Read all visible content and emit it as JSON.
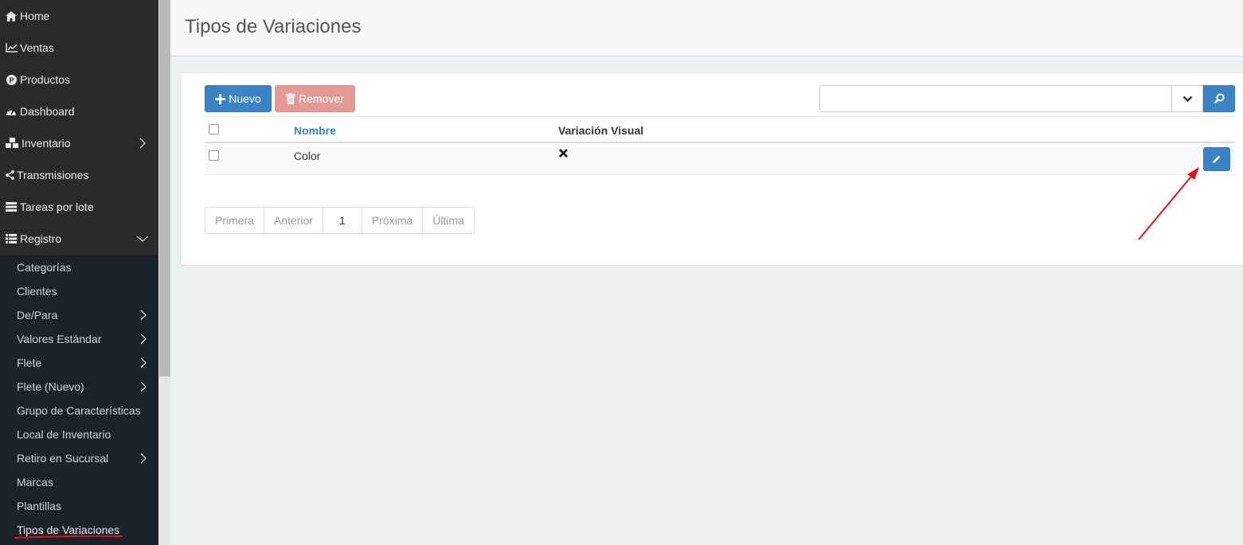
{
  "sidebar": {
    "items": [
      {
        "label": "Home",
        "icon": "home-icon"
      },
      {
        "label": "Ventas",
        "icon": "chart-line-icon"
      },
      {
        "label": "Productos",
        "icon": "product-badge-icon"
      },
      {
        "label": "Dashboard",
        "icon": "dashboard-gauge-icon"
      },
      {
        "label": "Inventario",
        "icon": "cubes-icon"
      },
      {
        "label": "Transmisiones",
        "icon": "share-icon"
      },
      {
        "label": "Tareas por lote",
        "icon": "tasks-icon"
      },
      {
        "label": "Registro",
        "icon": "list-icon"
      }
    ],
    "submenu": [
      {
        "label": "Categorías"
      },
      {
        "label": "Clientes"
      },
      {
        "label": "De/Para"
      },
      {
        "label": "Valores Estándar"
      },
      {
        "label": "Flete"
      },
      {
        "label": "Flete (Nuevo)"
      },
      {
        "label": "Grupo de Características"
      },
      {
        "label": "Local de Inventario"
      },
      {
        "label": "Retiro en Sucursal"
      },
      {
        "label": "Marcas"
      },
      {
        "label": "Plantillas"
      },
      {
        "label": "Tipos de Variaciones"
      }
    ]
  },
  "header": {
    "title": "Tipos de Variaciones"
  },
  "toolbar": {
    "new_label": "Nuevo",
    "remove_label": "Remover",
    "search_value": ""
  },
  "table": {
    "columns": [
      "Nombre",
      "Variación Visual"
    ],
    "rows": [
      {
        "nombre": "Color",
        "visual": "✖"
      }
    ]
  },
  "pagination": {
    "first": "Primera",
    "prev": "Anterior",
    "current": "1",
    "next": "Próxima",
    "last": "Última"
  },
  "colors": {
    "primary": "#3c83c6",
    "danger_disabled": "#e69a97",
    "sidebar_bg": "#2a2a2a",
    "submenu_bg": "#1b222a",
    "annotation_red": "#e8101a"
  }
}
